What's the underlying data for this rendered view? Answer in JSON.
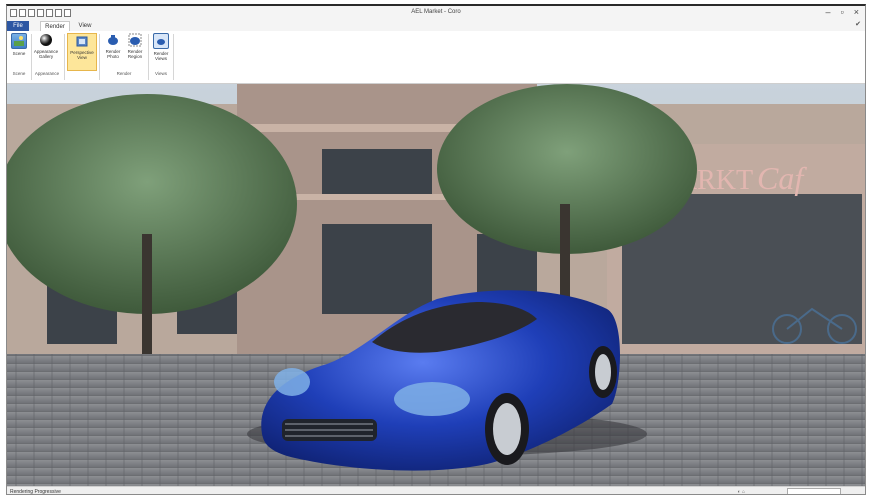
{
  "window": {
    "title": "AEL Market - Coro",
    "minimize_glyph": "–",
    "restore_glyph": "▫",
    "close_glyph": "×"
  },
  "tabs": [
    {
      "label": "File"
    },
    {
      "label": "Render"
    },
    {
      "label": "View"
    }
  ],
  "help_glyph": "✔",
  "ribbon": {
    "buttons": [
      {
        "label": "Scene",
        "icon": "scene-icon"
      },
      {
        "label": "Appearance Gallery",
        "icon": "sphere-icon"
      },
      {
        "label": "Perspective View",
        "icon": "camera-icon"
      },
      {
        "label": "Render Photo",
        "icon": "teapot-icon"
      },
      {
        "label": "Render Region",
        "icon": "teapot-region-icon"
      },
      {
        "label": "Render Views",
        "icon": "render-views-icon"
      }
    ],
    "groups": [
      {
        "label": "Scene"
      },
      {
        "label": "Appearance"
      },
      {
        "label": "Render"
      },
      {
        "label": "Views"
      }
    ]
  },
  "status": {
    "text": "Rendering Progressive",
    "icon_text": "◐ ⌂"
  },
  "colors": {
    "accent": "#2d57a3",
    "car_blue": "#1f3fb8",
    "active_button": "#fde69a"
  }
}
